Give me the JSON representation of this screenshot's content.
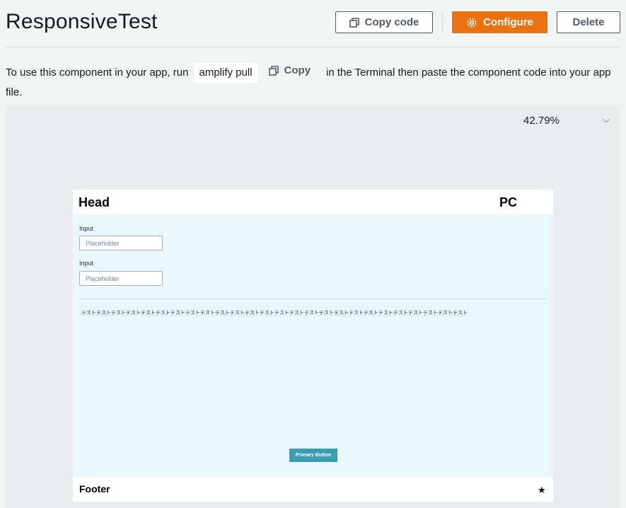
{
  "header": {
    "title": "ResponsiveTest",
    "copy_code_label": "Copy code",
    "configure_label": "Configure",
    "delete_label": "Delete"
  },
  "instructions": {
    "prefix": "To use this component in your app, run",
    "command": "amplify pull",
    "copy_label": "Copy",
    "suffix": "in the Terminal then paste the component code into your app file."
  },
  "preview": {
    "zoom": "42.79%",
    "head_title": "Head",
    "head_badge": "PC",
    "inputs": [
      {
        "label": "Input",
        "placeholder": "Placeholder"
      },
      {
        "label": "Input",
        "placeholder": "Placeholder"
      }
    ],
    "japanese_text": "テストテストテストテストテストテストテストテストテストテストテストテストテストテストテストテストテストテストテストテストテストテストテストテストテストテスト",
    "primary_button": "Primary Button",
    "footer_title": "Footer",
    "footer_icon": "★"
  },
  "colors": {
    "accent": "#ec7211",
    "primary_button": "#3a9db1",
    "canvas_body": "#e8f7fb"
  }
}
